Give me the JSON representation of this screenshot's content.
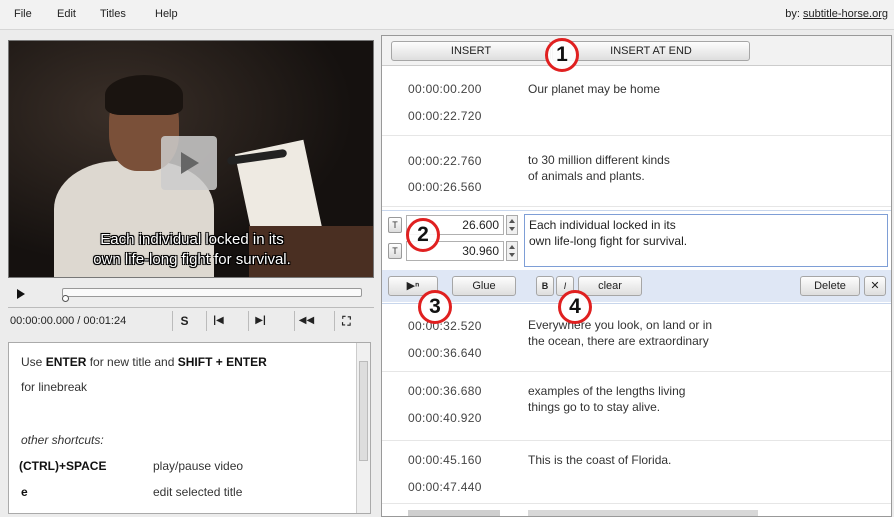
{
  "menu": {
    "file": "File",
    "edit": "Edit",
    "titles": "Titles",
    "help": "Help"
  },
  "credit": {
    "prefix": "by:",
    "link": "subtitle-horse.org"
  },
  "video": {
    "subtitle_line1": "Each individual locked in its",
    "subtitle_line2": "own life-long fight for survival."
  },
  "player": {
    "timecode": "00:00:00.000 / 00:01:24",
    "btn_s": "S",
    "btn_prev": "|◀",
    "btn_next": "▶|",
    "btn_rewind": "◀◀",
    "btn_fullscreen": "⛶"
  },
  "help": {
    "line1_pre": "Use ",
    "line1_key1": "ENTER",
    "line1_mid": " for new title and ",
    "line1_key2": "SHIFT + ENTER",
    "line2": "for linebreak",
    "other": "other shortcuts:",
    "s1_key": "(CTRL)+SPACE",
    "s1_desc": "play/pause video",
    "s2_key": "e",
    "s2_desc": "edit selected title"
  },
  "toolbar": {
    "insert": "INSERT",
    "insert_end": "INSERT AT END"
  },
  "markers": {
    "m1": "1",
    "m2": "2",
    "m3": "3",
    "m4": "4"
  },
  "subtitles": [
    {
      "start": "00:00:00.200",
      "end": "00:00:22.720",
      "line1": "Our planet may be home",
      "line2": ""
    },
    {
      "start": "00:00:22.760",
      "end": "00:00:26.560",
      "line1": "to 30 million different kinds",
      "line2": "of animals and plants."
    },
    {
      "start": "00:00:32.520",
      "end": "00:00:36.640",
      "line1": "Everywhere you look, on land or in",
      "line2": "the ocean, there are extraordinary"
    },
    {
      "start": "00:00:36.680",
      "end": "00:00:40.920",
      "line1": "examples of the lengths living",
      "line2": "things go to to stay alive."
    },
    {
      "start": "00:00:45.160",
      "end": "00:00:47.440",
      "line1": "This is the coast of Florida.",
      "line2": ""
    }
  ],
  "editing": {
    "start_visible": "26.600",
    "end_visible": "30.960",
    "t_btn": "T",
    "line1": "Each individual locked in its",
    "line2": "own life-long fight for survival.",
    "glue": "Glue",
    "bold": "B",
    "italic": "I",
    "clear": "clear",
    "delete": "Delete",
    "close": "✕"
  },
  "colors": {
    "marker": "#e02020",
    "edit_bg": "#dfe7f5"
  }
}
